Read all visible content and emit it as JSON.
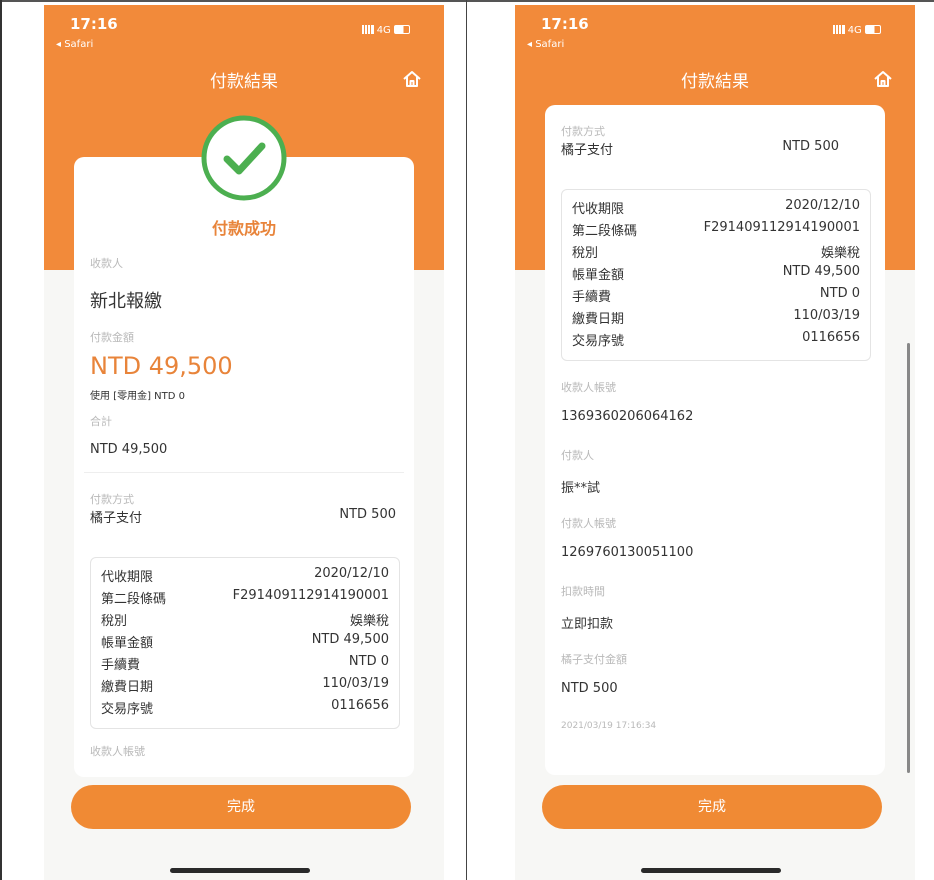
{
  "left": {
    "status": {
      "time": "17:16",
      "back": "Safari",
      "network": "4G"
    },
    "header": {
      "title": "付款結果"
    },
    "success": {
      "text": "付款成功"
    },
    "payee": {
      "label": "收款人",
      "value": "新北報繳"
    },
    "amount": {
      "label": "付款金額",
      "value": "NTD 49,500",
      "note": "使用 [零用金] NTD 0"
    },
    "total": {
      "label": "合計",
      "value": "NTD 49,500"
    },
    "method": {
      "label": "付款方式",
      "name": "橘子支付",
      "amount": "NTD 500"
    },
    "details": [
      {
        "k": "代收期限",
        "v": "2020/12/10"
      },
      {
        "k": "第二段條碼",
        "v": "F291409112914190001"
      },
      {
        "k": "稅別",
        "v": "娛樂稅"
      },
      {
        "k": "帳單金額",
        "v": "NTD 49,500"
      },
      {
        "k": "手續費",
        "v": "NTD 0"
      },
      {
        "k": "繳費日期",
        "v": "110/03/19"
      },
      {
        "k": "交易序號",
        "v": "0116656"
      }
    ],
    "payee_account": {
      "label": "收款人帳號"
    },
    "done": "完成"
  },
  "right": {
    "status": {
      "time": "17:16",
      "back": "Safari",
      "network": "4G"
    },
    "header": {
      "title": "付款結果"
    },
    "method": {
      "label": "付款方式",
      "name": "橘子支付",
      "amount": "NTD 500"
    },
    "details": [
      {
        "k": "代收期限",
        "v": "2020/12/10"
      },
      {
        "k": "第二段條碼",
        "v": "F291409112914190001"
      },
      {
        "k": "稅別",
        "v": "娛樂稅"
      },
      {
        "k": "帳單金額",
        "v": "NTD 49,500"
      },
      {
        "k": "手續費",
        "v": "NTD 0"
      },
      {
        "k": "繳費日期",
        "v": "110/03/19"
      },
      {
        "k": "交易序號",
        "v": "0116656"
      }
    ],
    "payee_account": {
      "label": "收款人帳號",
      "value": "1369360206064162"
    },
    "payer": {
      "label": "付款人",
      "value": "振**試"
    },
    "payer_account": {
      "label": "付款人帳號",
      "value": "1269760130051100"
    },
    "debit_time": {
      "label": "扣款時間",
      "value": "立即扣款"
    },
    "orange_amount": {
      "label": "橘子支付金額",
      "value": "NTD 500"
    },
    "timestamp": "2021/03/19 17:16:34",
    "done": "完成"
  },
  "colors": {
    "brand_orange": "#f28a3a",
    "success_green": "#4caf50",
    "amount_orange": "#e8843a"
  },
  "icons": [
    "home-icon",
    "check-circle-icon",
    "signal-icon",
    "battery-icon"
  ]
}
